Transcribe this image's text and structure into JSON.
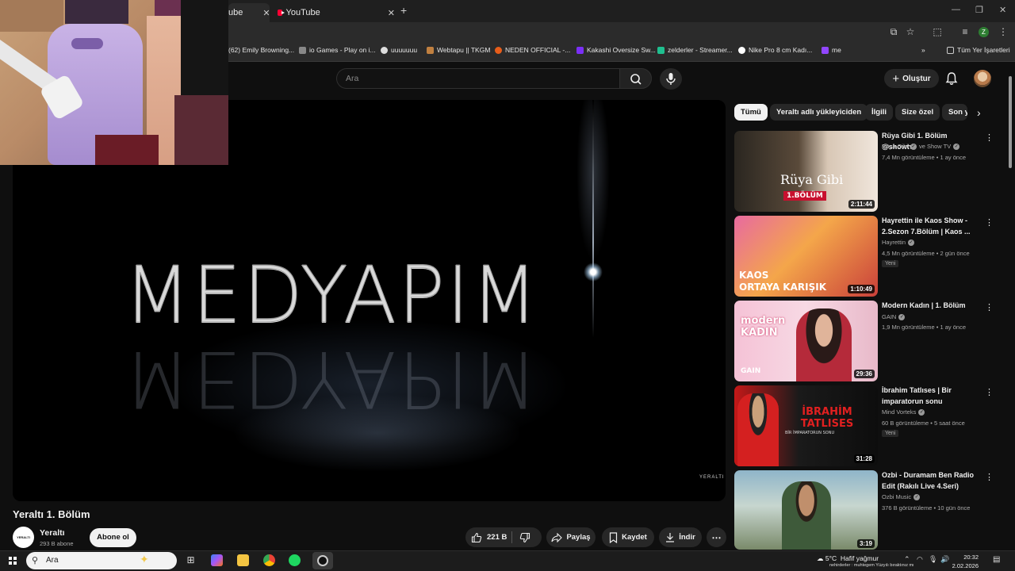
{
  "browser": {
    "tabs": [
      {
        "label": "ube"
      },
      {
        "label": "YouTube"
      }
    ],
    "bookmarks": [
      {
        "label": "(62) Emily Browning..."
      },
      {
        "label": "io Games - Play on i..."
      },
      {
        "label": "uuuuuuu"
      },
      {
        "label": "Webtapu || TKGM"
      },
      {
        "label": "NEDEN OFFICIAL -..."
      },
      {
        "label": "Kakashi Oversize Sw..."
      },
      {
        "label": "zelderler - Streamer..."
      },
      {
        "label": "Nike Pro 8 cm Kadı..."
      },
      {
        "label": "me"
      }
    ],
    "all_bookmarks": "Tüm Yer İşaretleri",
    "profile_initial": "Z"
  },
  "header": {
    "search_placeholder": "Ara",
    "create_label": "Oluştur"
  },
  "player": {
    "brand_text": "MEDYAPIM",
    "watermark": "YERALTI"
  },
  "video": {
    "title": "Yeraltı 1. Bölüm",
    "channel_name": "Yeraltı",
    "channel_subs": "293 B abone",
    "channel_avatar_text": "YERALTI",
    "subscribe_label": "Abone ol",
    "likes": "221 B",
    "share_label": "Paylaş",
    "save_label": "Kaydet",
    "download_label": "İndir"
  },
  "chips": [
    "Tümü",
    "Yeraltı adlı yükleyiciden",
    "İlgili",
    "Size özel",
    "Son y"
  ],
  "recommendations": [
    {
      "title": "Rüya Gibi 1. Bölüm @showtv",
      "channel": "Rüya Gibi",
      "channel_extra": "ve Show TV",
      "stats": "7,4 Mn görüntüleme • 1 ay önce",
      "duration": "2:11:44",
      "badge": "",
      "thumb_text": "Rüya Gibi",
      "thumb_sub": "1.BÖLÜM"
    },
    {
      "title": "Hayrettin ile Kaos Show - 2.Sezon 7.Bölüm | Kaos ...",
      "channel": "Hayrettin",
      "channel_extra": "",
      "stats": "4,5 Mn görüntüleme • 2 gün önce",
      "duration": "1:10:49",
      "badge": "Yeni",
      "thumb_text": "KAOS",
      "thumb_sub": "ORTAYA KARIŞIK"
    },
    {
      "title": "Modern Kadın | 1. Bölüm",
      "channel": "GAIN",
      "channel_extra": "",
      "stats": "1,9 Mn görüntüleme • 1 ay önce",
      "duration": "29:36",
      "badge": "",
      "thumb_text": "modern KADIN",
      "thumb_sub": "GAIN"
    },
    {
      "title": "İbrahim Tatlıses | Bir imparatorun sonu",
      "channel": "Mind Vorteks",
      "channel_extra": "",
      "stats": "60 B görüntüleme • 5 saat önce",
      "duration": "31:28",
      "badge": "Yeni",
      "thumb_text": "İBRAHİM TATLISES",
      "thumb_sub": "BİR İMPARATORUN SONU"
    },
    {
      "title": "Ozbi - Duramam Ben Radio Edit (Rakılı Live 4.Seri)",
      "channel": "Ozbi Music",
      "channel_extra": "",
      "stats": "376 B görüntüleme • 10 gün önce",
      "duration": "3:19",
      "badge": "",
      "thumb_text": "",
      "thumb_sub": ""
    }
  ],
  "taskbar": {
    "search_placeholder": "Ara",
    "weather_temp": "5°C",
    "weather_desc": "Hafif yağmur",
    "time": "20:32",
    "date": "2.02.2026",
    "ticker": "nehirderler : muhtegem Yüzyılı bıraktınız mı"
  }
}
